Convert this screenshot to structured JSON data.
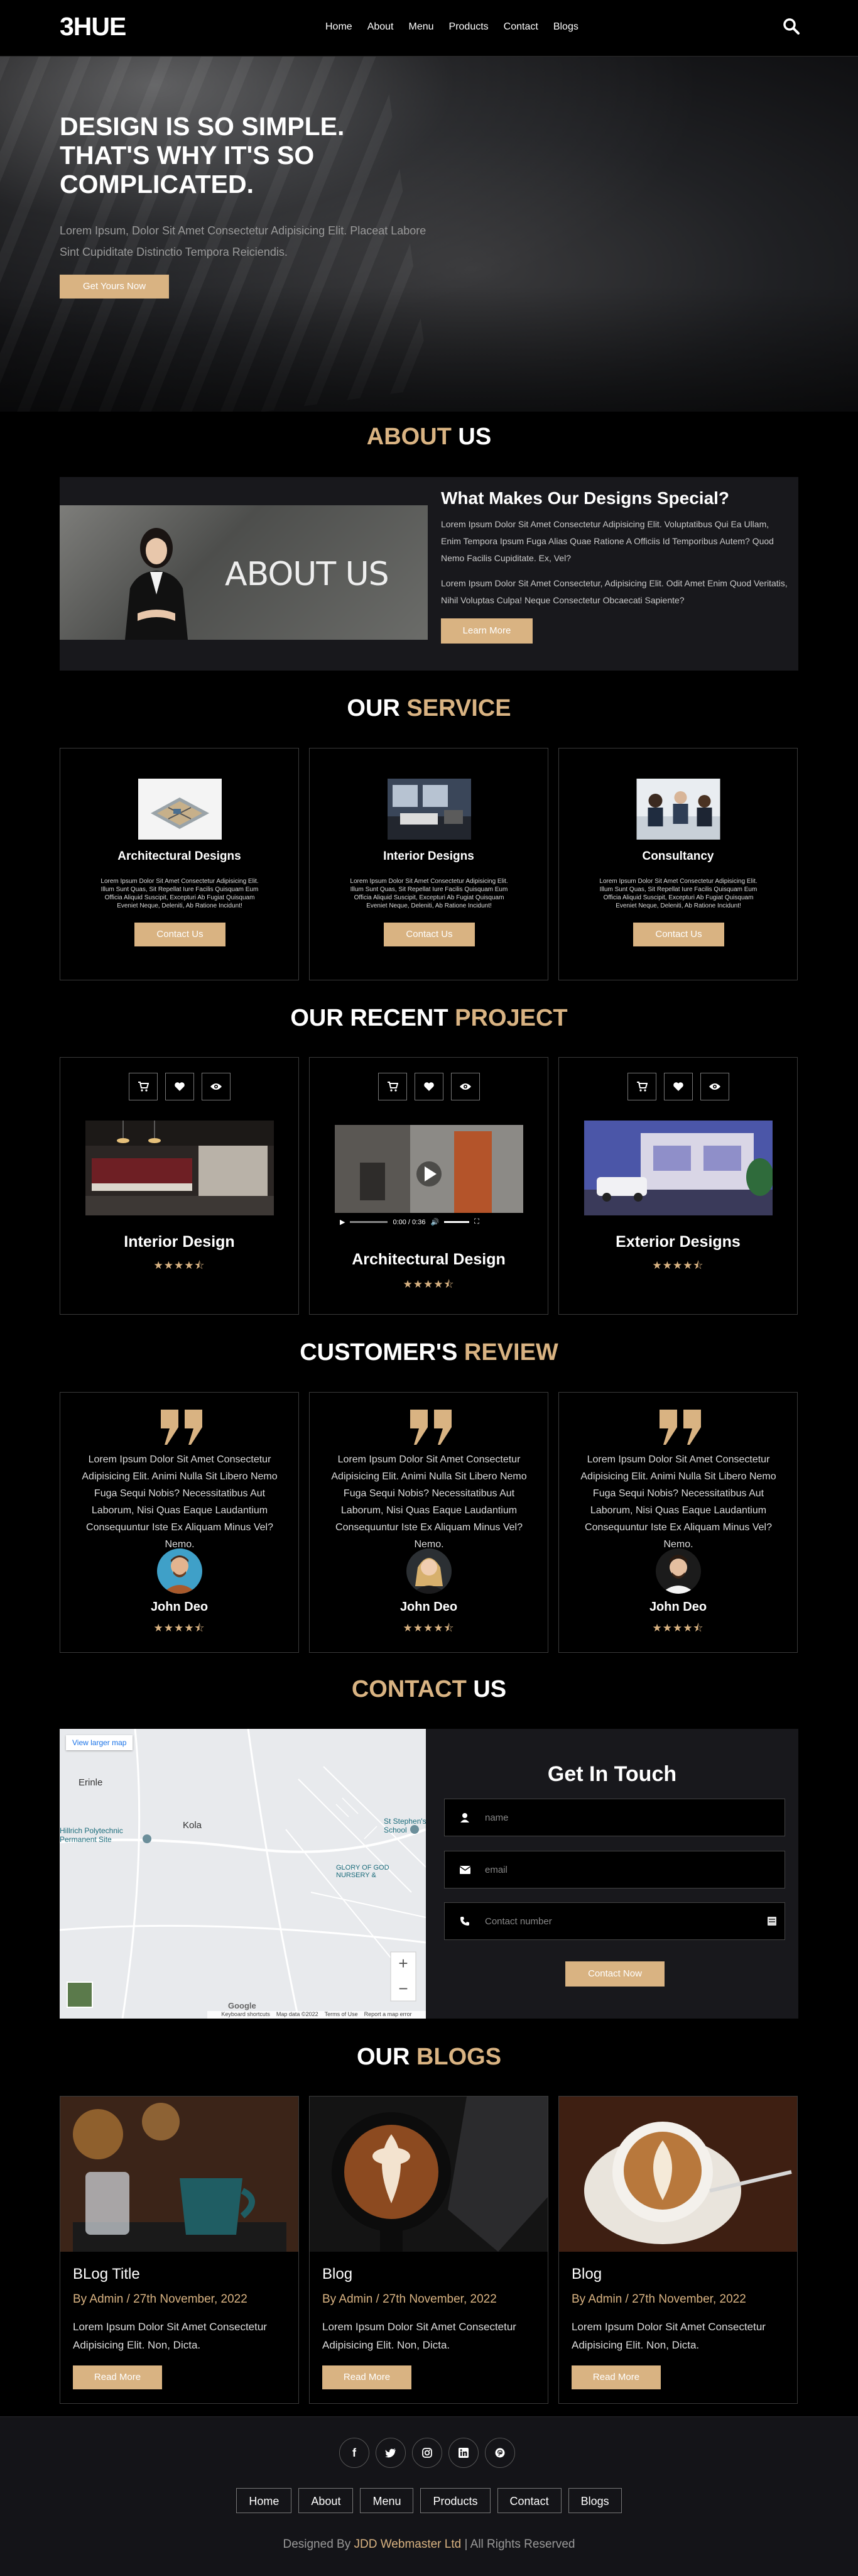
{
  "header": {
    "logo": "3HUE",
    "nav": [
      "Home",
      "About",
      "Menu",
      "Products",
      "Contact",
      "Blogs"
    ]
  },
  "hero": {
    "title": "Design Is So Simple. That's Why It's So Complicated.",
    "subtitle": "Lorem Ipsum, Dolor Sit Amet Consectetur Adipisicing Elit. Placeat Labore Sint Cupiditate Distinctio Tempora Reiciendis.",
    "button": "Get Yours Now"
  },
  "about": {
    "title_accent": "About",
    "title_rest": " Us",
    "image_text": "ABOUT US",
    "heading": "What Makes Our Designs Special?",
    "para1": "Lorem Ipsum Dolor Sit Amet Consectetur Adipisicing Elit. Voluptatibus Qui Ea Ullam, Enim Tempora Ipsum Fuga Alias Quae Ratione A Officiis Id Temporibus Autem? Quod Nemo Facilis Cupiditate. Ex, Vel?",
    "para2": "Lorem Ipsum Dolor Sit Amet Consectetur, Adipisicing Elit. Odit Amet Enim Quod Veritatis, Nihil Voluptas Culpa! Neque Consectetur Obcaecati Sapiente?",
    "button": "Learn More"
  },
  "service": {
    "title_rest": "Our ",
    "title_accent": "Service",
    "cards": [
      {
        "title": "Architectural Designs",
        "desc": "Lorem Ipsum Dolor Sit Amet Consectetur Adipisicing Elit. Illum Sunt Quas, Sit Repellat Iure Facilis Quisquam Eum Officia Aliquid Suscipit, Excepturi Ab Fugiat Quisquam Eveniet Neque, Deleniti, Ab Ratione Incidunt!",
        "button": "Contact Us"
      },
      {
        "title": "Interior Designs",
        "desc": "Lorem Ipsum Dolor Sit Amet Consectetur Adipisicing Elit. Illum Sunt Quas, Sit Repellat Iure Facilis Quisquam Eum Officia Aliquid Suscipit, Excepturi Ab Fugiat Quisquam Eveniet Neque, Deleniti, Ab Ratione Incidunt!",
        "button": "Contact Us"
      },
      {
        "title": "Consultancy",
        "desc": "Lorem Ipsum Dolor Sit Amet Consectetur Adipisicing Elit. Illum Sunt Quas, Sit Repellat Iure Facilis Quisquam Eum Officia Aliquid Suscipit, Excepturi Ab Fugiat Quisquam Eveniet Neque, Deleniti, Ab Ratione Incidunt!",
        "button": "Contact Us"
      }
    ]
  },
  "projects": {
    "title_rest": "Our Recent ",
    "title_accent": "Project",
    "cards": [
      {
        "title": "Interior Design",
        "stars": "★★★★⯪"
      },
      {
        "title": "Architectural Design",
        "stars": "★★★★⯪",
        "video_time": "0:00 / 0:36"
      },
      {
        "title": "Exterior Designs",
        "stars": "★★★★⯪"
      }
    ]
  },
  "reviews": {
    "title_rest": "Customer's ",
    "title_accent": "Review",
    "cards": [
      {
        "text": "Lorem Ipsum Dolor Sit Amet Consectetur Adipisicing Elit. Animi Nulla Sit Libero Nemo Fuga Sequi Nobis? Necessitatibus Aut Laborum, Nisi Quas Eaque Laudantium Consequuntur Iste Ex Aliquam Minus Vel? Nemo.",
        "name": "John Deo",
        "stars": "★★★★⯪"
      },
      {
        "text": "Lorem Ipsum Dolor Sit Amet Consectetur Adipisicing Elit. Animi Nulla Sit Libero Nemo Fuga Sequi Nobis? Necessitatibus Aut Laborum, Nisi Quas Eaque Laudantium Consequuntur Iste Ex Aliquam Minus Vel? Nemo.",
        "name": "John Deo",
        "stars": "★★★★⯪"
      },
      {
        "text": "Lorem Ipsum Dolor Sit Amet Consectetur Adipisicing Elit. Animi Nulla Sit Libero Nemo Fuga Sequi Nobis? Necessitatibus Aut Laborum, Nisi Quas Eaque Laudantium Consequuntur Iste Ex Aliquam Minus Vel? Nemo.",
        "name": "John Deo",
        "stars": "★★★★⯪"
      }
    ]
  },
  "contact": {
    "title_accent": "Contact",
    "title_rest": " Us",
    "heading": "Get In Touch",
    "name_placeholder": "name",
    "email_placeholder": "email",
    "phone_placeholder": "Contact number",
    "button": "Contact Now",
    "map": {
      "larger_map": "View larger map",
      "labels": [
        "Erinle",
        "Kola",
        "Hillrich Polytechnic Permanent Site",
        "St Stephen's School",
        "GLORY OF GOD NURSERY &"
      ],
      "google": "Google",
      "footer_items": [
        "Keyboard shortcuts",
        "Map data ©2022",
        "Terms of Use",
        "Report a map error"
      ]
    }
  },
  "blogs": {
    "title_rest": "Our ",
    "title_accent": "Blogs",
    "cards": [
      {
        "title": "BLog Title",
        "meta": "By Admin / 27th November, 2022",
        "desc": "Lorem Ipsum Dolor Sit Amet Consectetur Adipisicing Elit. Non, Dicta.",
        "button": "Read More"
      },
      {
        "title": "Blog",
        "meta": "By Admin / 27th November, 2022",
        "desc": "Lorem Ipsum Dolor Sit Amet Consectetur Adipisicing Elit. Non, Dicta.",
        "button": "Read More"
      },
      {
        "title": "Blog",
        "meta": "By Admin / 27th November, 2022",
        "desc": "Lorem Ipsum Dolor Sit Amet Consectetur Adipisicing Elit. Non, Dicta.",
        "button": "Read More"
      }
    ]
  },
  "footer": {
    "social": [
      "facebook-icon",
      "twitter-icon",
      "instagram-icon",
      "linkedin-icon",
      "pinterest-icon"
    ],
    "nav": [
      "Home",
      "About",
      "Menu",
      "Products",
      "Contact",
      "Blogs"
    ],
    "copy_prefix": "Designed By ",
    "copy_link": "JDD Webmaster Ltd",
    "copy_suffix": " | All Rights Reserved"
  },
  "colors": {
    "accent": "#d9b382",
    "background": "#000000",
    "panel": "#18181c"
  }
}
